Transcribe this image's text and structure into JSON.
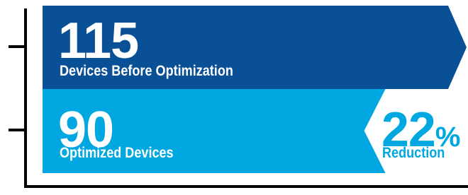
{
  "chart_data": {
    "type": "bar",
    "categories": [
      "Devices Before Optimization",
      "Optimized Devices"
    ],
    "values": [
      115,
      90
    ],
    "value_labels": [
      "115",
      "90"
    ],
    "reduction": {
      "value": "22",
      "unit": "%",
      "label": "Reduction"
    },
    "colors": {
      "before": "#0a5096",
      "after": "#00a7e1",
      "axis": "#000000",
      "reduction_text": "#00a7e1"
    },
    "grid": false,
    "legend": "none"
  }
}
